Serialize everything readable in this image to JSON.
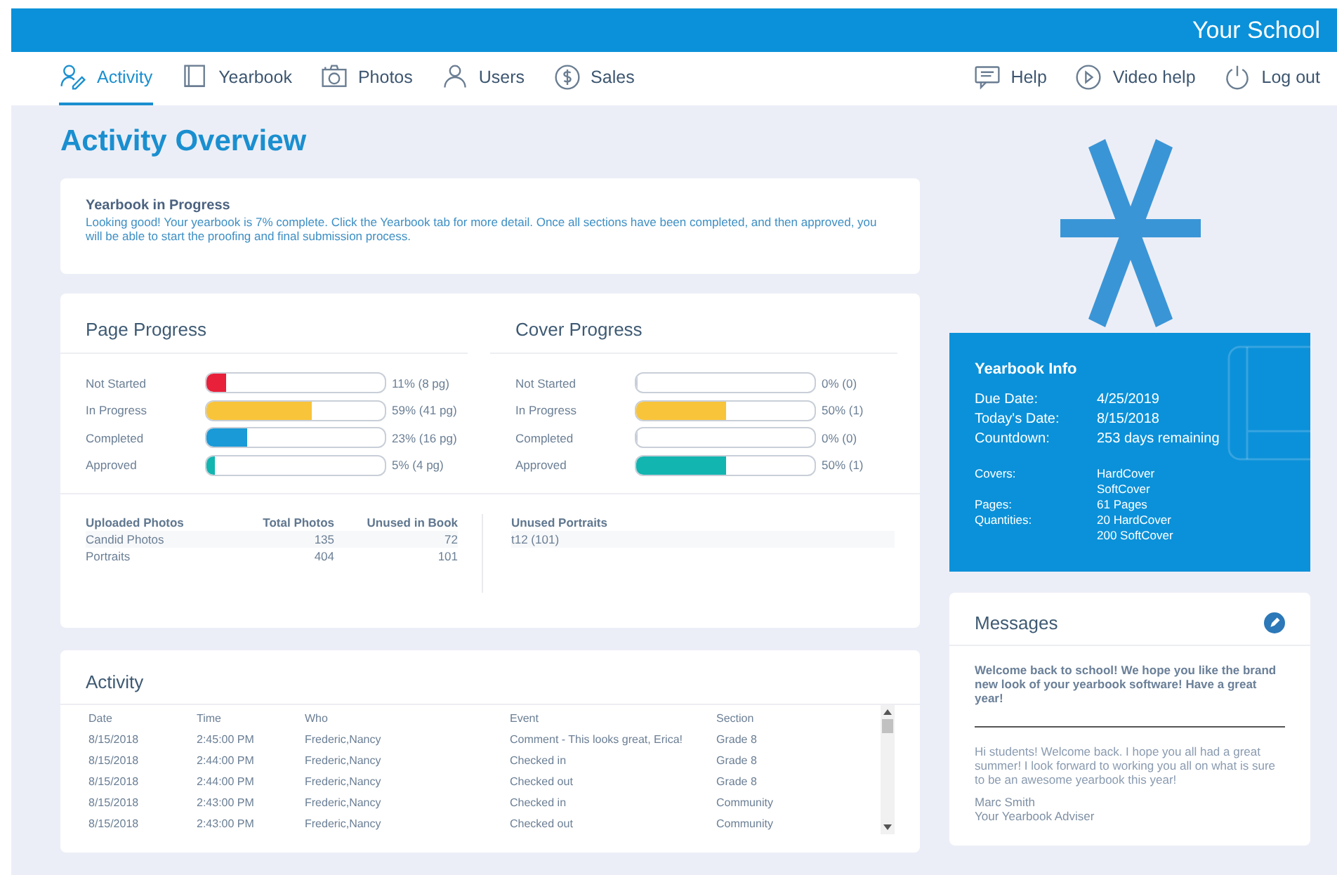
{
  "header": {
    "school": "Your School"
  },
  "nav": {
    "tabs": [
      {
        "label": "Activity",
        "selected": true
      },
      {
        "label": "Yearbook",
        "selected": false
      },
      {
        "label": "Photos",
        "selected": false
      },
      {
        "label": "Users",
        "selected": false
      },
      {
        "label": "Sales",
        "selected": false
      }
    ],
    "actions": [
      {
        "label": "Help"
      },
      {
        "label": "Video help"
      },
      {
        "label": "Log out"
      }
    ]
  },
  "page_title": "Activity Overview",
  "notice": {
    "title": "Yearbook in Progress",
    "text": "Looking good! Your yearbook is 7% complete. Click the Yearbook tab for more detail. Once all sections have been completed, and then approved, you will be able to start the proofing and final submission process."
  },
  "progress": [
    {
      "title": "Page Progress",
      "rows": [
        {
          "label": "Not Started",
          "level": 0.11,
          "color": "#e8203a",
          "reading": "11% (8 pg)"
        },
        {
          "label": "In Progress",
          "level": 0.59,
          "color": "#f8c43a",
          "reading": "59% (41 pg)"
        },
        {
          "label": "Completed",
          "level": 0.23,
          "color": "#1a9ad6",
          "reading": "23% (16 pg)"
        },
        {
          "label": "Approved",
          "level": 0.05,
          "color": "#12b5b0",
          "reading": "5% (4 pg)"
        }
      ]
    },
    {
      "title": "Cover Progress",
      "rows": [
        {
          "label": "Not Started",
          "level": 0,
          "reading": "0% (0)"
        },
        {
          "label": "In Progress",
          "level": 0.5,
          "color": "#f8c43a",
          "reading": "50% (1)"
        },
        {
          "label": "Completed",
          "level": 0,
          "reading": "0% (0)"
        },
        {
          "label": "Approved",
          "level": 0.5,
          "color": "#12b5b0",
          "reading": "50% (1)"
        }
      ]
    }
  ],
  "photos": {
    "columns": [
      "Uploaded Photos",
      "Total Photos",
      "Unused in Book"
    ],
    "rows": [
      [
        "Candid Photos",
        "135",
        "72"
      ],
      [
        "Portraits",
        "404",
        "101"
      ]
    ]
  },
  "portraits": {
    "title": "Unused Portraits",
    "rows": [
      "t12 (101)"
    ]
  },
  "activity": {
    "title": "Activity",
    "columns": [
      "Date",
      "Time",
      "Who",
      "Event",
      "Section"
    ],
    "rows": [
      [
        "8/15/2018",
        "2:45:00 PM",
        "Frederic,Nancy",
        "Comment - This looks great, Erica!",
        "Grade 8"
      ],
      [
        "8/15/2018",
        "2:44:00 PM",
        "Frederic,Nancy",
        "Checked in",
        "Grade 8"
      ],
      [
        "8/15/2018",
        "2:44:00 PM",
        "Frederic,Nancy",
        "Checked out",
        "Grade 8"
      ],
      [
        "8/15/2018",
        "2:43:00 PM",
        "Frederic,Nancy",
        "Checked in",
        "Community"
      ],
      [
        "8/15/2018",
        "2:43:00 PM",
        "Frederic,Nancy",
        "Checked out",
        "Community"
      ]
    ]
  },
  "yearbook_info": {
    "title": "Yearbook Info",
    "main": [
      [
        "Due Date:",
        "4/25/2019"
      ],
      [
        "Today's Date:",
        "8/15/2018"
      ],
      [
        "Countdown:",
        "253 days remaining"
      ]
    ],
    "details": [
      {
        "label": "Covers:",
        "value": "HardCover"
      },
      {
        "value": "SoftCover"
      },
      {
        "label": "Pages:",
        "value": "61 Pages"
      },
      {
        "label": "Quantities:",
        "value": "20 HardCover"
      },
      {
        "value": "200 SoftCover"
      }
    ]
  },
  "messages": {
    "title": "Messages",
    "highlight": "Welcome back to school! We hope you like the brand new look of your yearbook software! Have a great year!",
    "body": "Hi students! Welcome back. I hope you all had a great summer! I look forward to working you all on what is sure to be an awesome yearbook this year!",
    "signature": [
      "Marc Smith",
      "Your Yearbook Adviser"
    ]
  }
}
